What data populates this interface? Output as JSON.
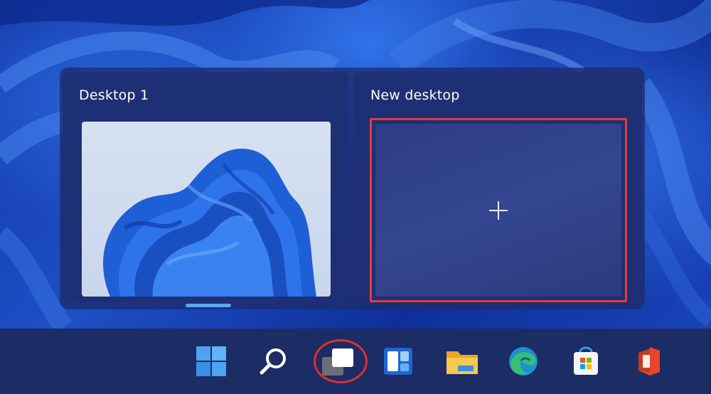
{
  "task_view": {
    "desktops": [
      {
        "title": "Desktop 1",
        "active": true
      },
      {
        "title": "New desktop",
        "action": "add"
      }
    ]
  },
  "taskbar": {
    "items": [
      {
        "name": "Start",
        "icon": "windows-logo-icon"
      },
      {
        "name": "Search",
        "icon": "search-icon"
      },
      {
        "name": "Task View",
        "icon": "task-view-icon",
        "highlighted": true
      },
      {
        "name": "Widgets",
        "icon": "widgets-icon"
      },
      {
        "name": "File Explorer",
        "icon": "folder-icon"
      },
      {
        "name": "Microsoft Edge",
        "icon": "edge-icon"
      },
      {
        "name": "Microsoft Store",
        "icon": "store-icon"
      },
      {
        "name": "Office",
        "icon": "office-icon"
      }
    ]
  },
  "colors": {
    "highlight": "#e63a35",
    "accent": "#5aa7f2",
    "taskbar": "#1c2c64"
  }
}
